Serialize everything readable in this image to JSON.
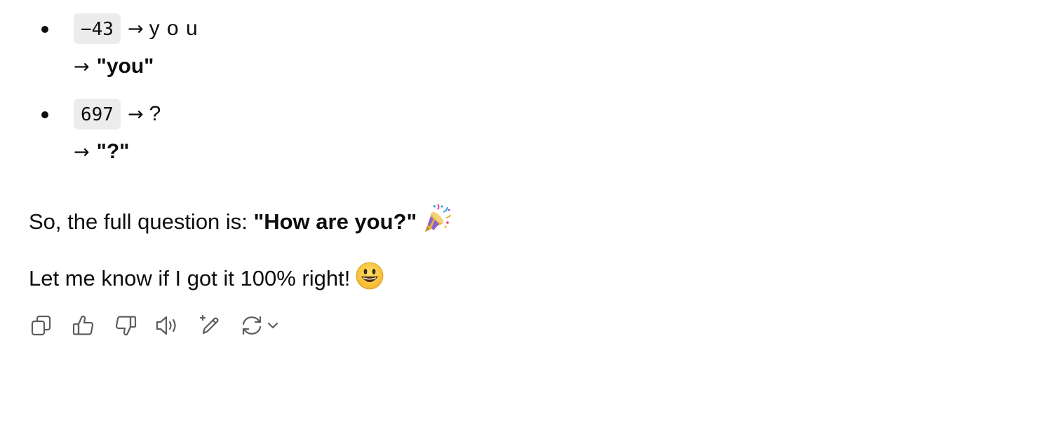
{
  "decode_list": [
    {
      "code": "−43",
      "arrow": "→",
      "decoded": "y o u",
      "result_arrow": "→",
      "result": "\"you\""
    },
    {
      "code": "697",
      "arrow": "→",
      "decoded": "?",
      "result_arrow": "→",
      "result": "\"?\""
    }
  ],
  "summary": {
    "prefix": "So, the full question is: ",
    "question": "\"How are you?\"",
    "emoji_icon": "party-popper-icon"
  },
  "closing": {
    "text": "Let me know if I got it 100% right!",
    "emoji_icon": "smiley-icon"
  },
  "actions": [
    {
      "name": "copy-icon",
      "label": "Copy"
    },
    {
      "name": "thumbs-up-icon",
      "label": "Good response"
    },
    {
      "name": "thumbs-down-icon",
      "label": "Bad response"
    },
    {
      "name": "read-aloud-icon",
      "label": "Read aloud"
    },
    {
      "name": "edit-sparkle-icon",
      "label": "Edit in canvas"
    },
    {
      "name": "regenerate-icon",
      "label": "Regenerate"
    }
  ],
  "colors": {
    "text": "#0d0d0d",
    "chip_bg": "#ececec",
    "icon": "#5d5d5d"
  }
}
